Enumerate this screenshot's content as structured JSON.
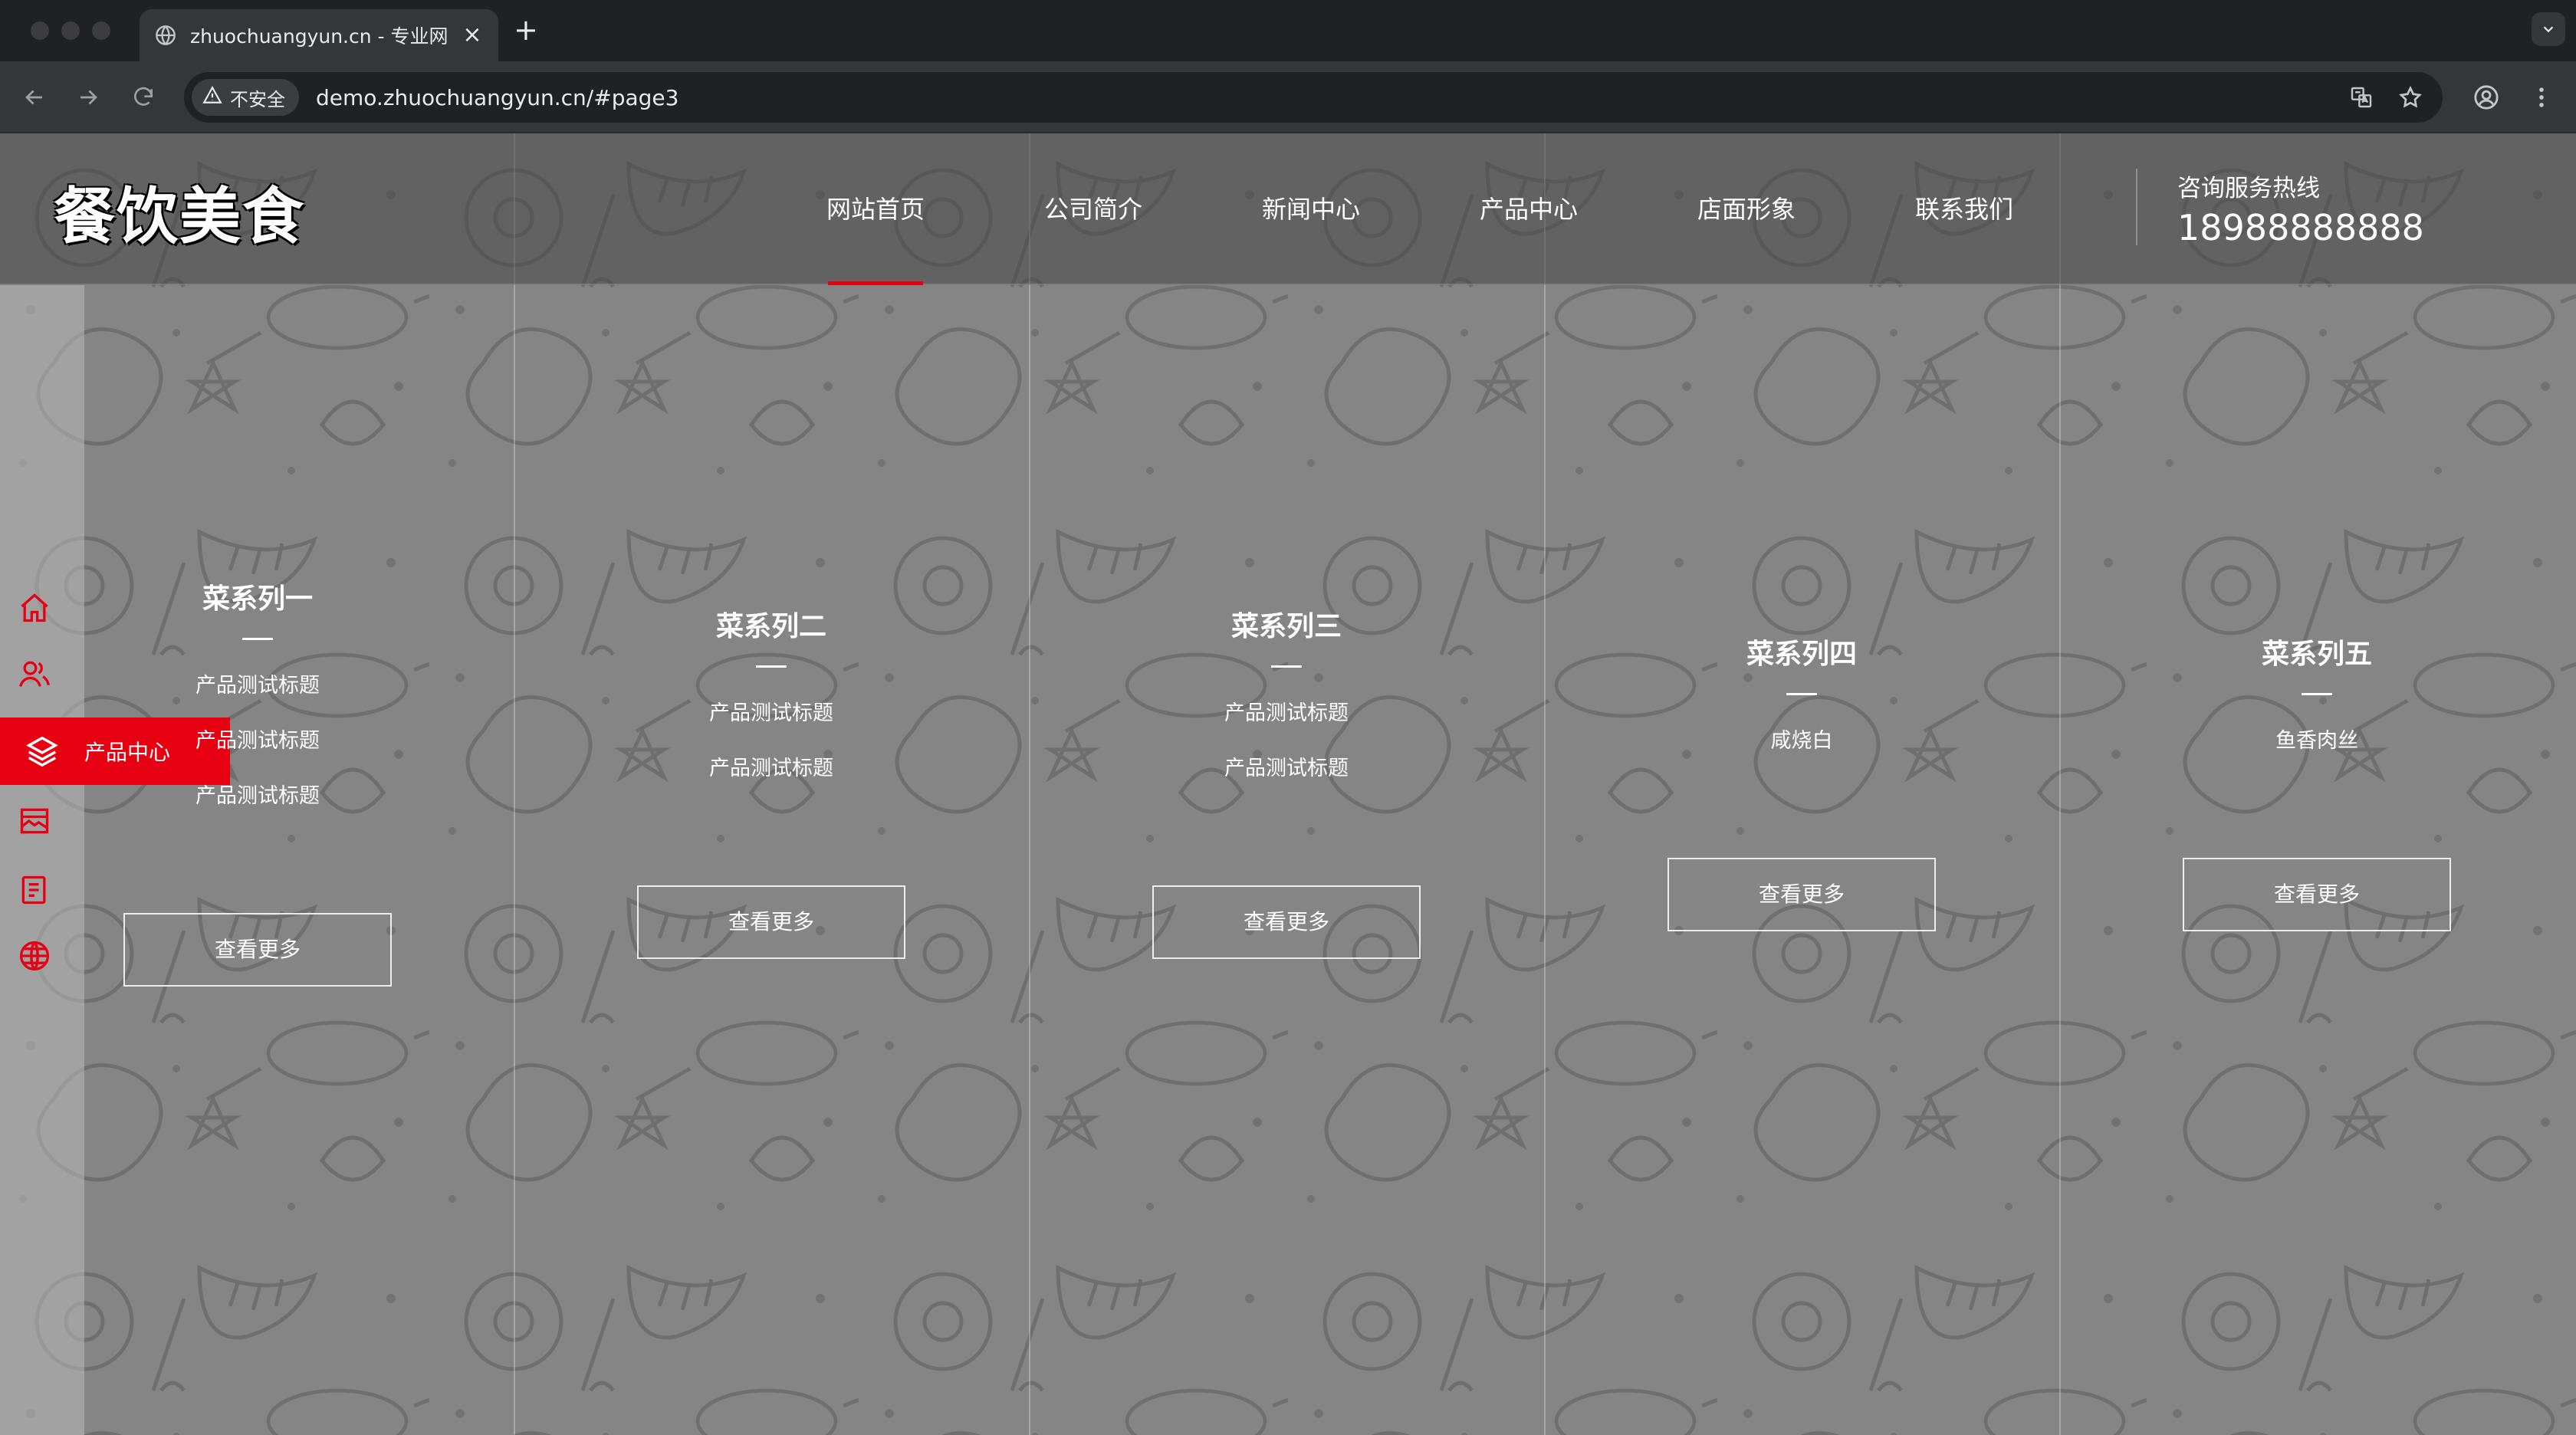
{
  "browser": {
    "tab_title": "zhuochuangyun.cn - 专业网站",
    "new_tab": "+",
    "close": "×",
    "security_label": "不安全",
    "url": "demo.zhuochuangyun.cn/#page3"
  },
  "site": {
    "logo": "餐饮美食",
    "nav": [
      "网站首页",
      "公司简介",
      "新闻中心",
      "产品中心",
      "店面形象",
      "联系我们"
    ],
    "hotline_label": "咨询服务热线",
    "hotline_number": "18988888888"
  },
  "rail": {
    "active_label": "产品中心",
    "icons": [
      "home-icon",
      "users-icon",
      "layers-icon",
      "store-icon",
      "document-icon",
      "globe-icon"
    ]
  },
  "series": [
    {
      "title": "菜系列一",
      "items": [
        "产品测试标题",
        "产品测试标题",
        "产品测试标题"
      ],
      "more": "查看更多"
    },
    {
      "title": "菜系列二",
      "items": [
        "产品测试标题",
        "产品测试标题"
      ],
      "more": "查看更多"
    },
    {
      "title": "菜系列三",
      "items": [
        "产品测试标题",
        "产品测试标题"
      ],
      "more": "查看更多"
    },
    {
      "title": "菜系列四",
      "items": [
        "咸烧白"
      ],
      "more": "查看更多"
    },
    {
      "title": "菜系列五",
      "items": [
        "鱼香肉丝"
      ],
      "more": "查看更多"
    }
  ],
  "colors": {
    "accent": "#e60012",
    "overlay": "#7e7e7e",
    "chrome_dark": "#202124",
    "chrome_toolbar": "#35363a"
  }
}
